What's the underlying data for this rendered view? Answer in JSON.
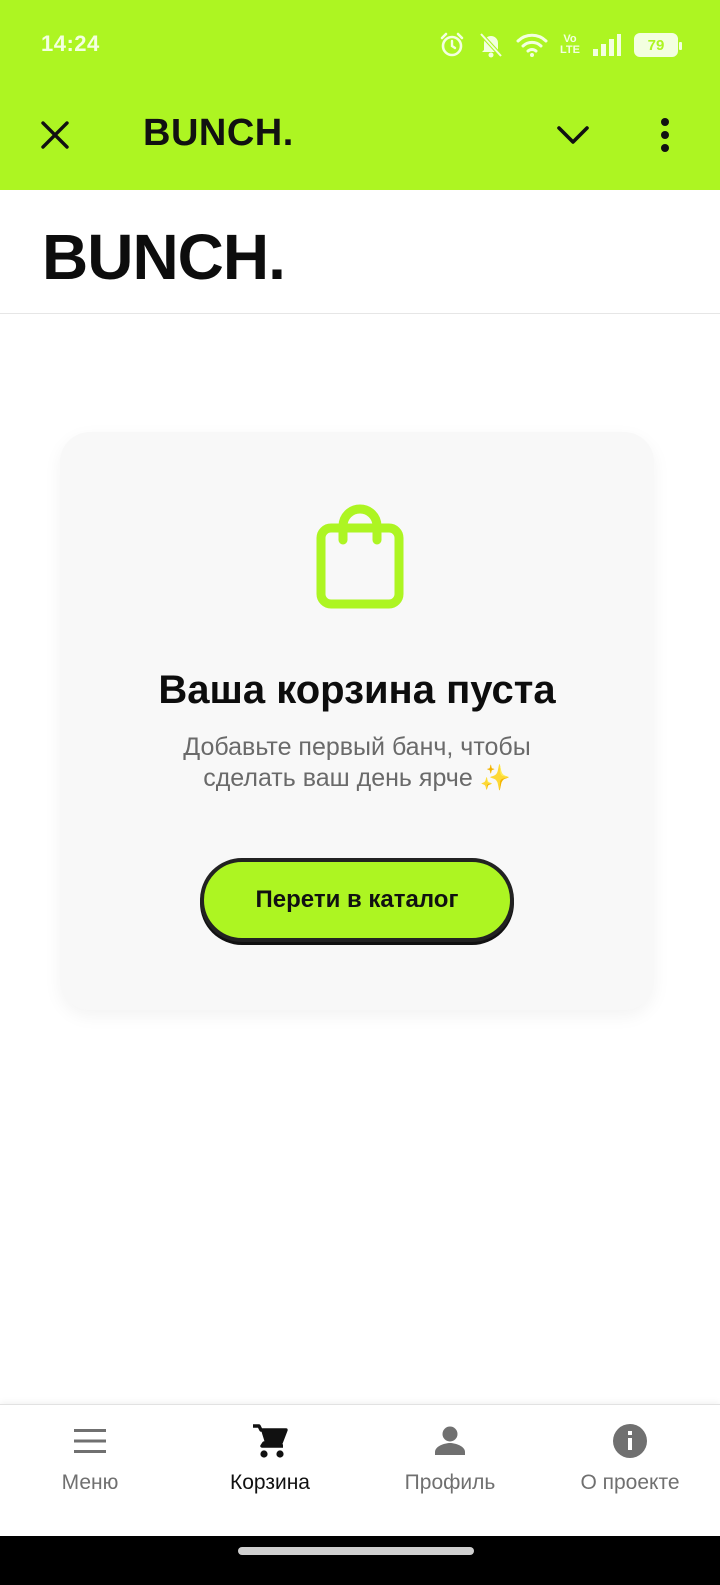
{
  "status_bar": {
    "time": "14:24",
    "battery": "79",
    "icons": [
      "alarm-icon",
      "bell-muted-icon",
      "wifi-icon",
      "volte-icon",
      "signal-icon",
      "battery-icon"
    ],
    "volte_top": "Vo",
    "volte_bottom": "LTE"
  },
  "app_bar": {
    "title": "BUNCH.",
    "close_icon": "close-icon",
    "chevron_icon": "chevron-down-icon",
    "more_icon": "more-vert-icon"
  },
  "site_header": {
    "logo": "BUNCH."
  },
  "empty_cart": {
    "icon": "shopping-bag-icon",
    "title": "Ваша корзина пуста",
    "subtitle": "Добавьте первый банч, чтобы сделать ваш день ярче ✨",
    "button_label": "Перети в каталог"
  },
  "bottom_nav": {
    "items": [
      {
        "label": "Меню",
        "icon": "menu-icon",
        "active": false
      },
      {
        "label": "Корзина",
        "icon": "cart-icon",
        "active": true
      },
      {
        "label": "Профиль",
        "icon": "person-icon",
        "active": false
      },
      {
        "label": "О проекте",
        "icon": "info-icon",
        "active": false
      }
    ]
  },
  "colors": {
    "accent": "#adf522",
    "card_bg": "#f8f8f8",
    "text_dark": "#111111",
    "text_muted": "#6a6a6a"
  }
}
